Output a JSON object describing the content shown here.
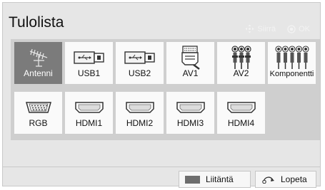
{
  "header": {
    "title": "Tulolista",
    "move_hint": "Siirrä",
    "ok_hint": "OK"
  },
  "inputs": [
    {
      "label": "Antenni",
      "icon": "antenna-icon",
      "selected": true
    },
    {
      "label": "USB1",
      "icon": "usb-icon",
      "selected": false
    },
    {
      "label": "USB2",
      "icon": "usb-icon",
      "selected": false
    },
    {
      "label": "AV1",
      "icon": "scart-icon",
      "selected": false
    },
    {
      "label": "AV2",
      "icon": "rca-3-icon",
      "selected": false
    },
    {
      "label": "Komponentti",
      "icon": "rca-5-icon",
      "selected": false
    },
    {
      "label": "RGB",
      "icon": "vga-icon",
      "selected": false
    },
    {
      "label": "HDMI1",
      "icon": "hdmi-icon",
      "selected": false
    },
    {
      "label": "HDMI2",
      "icon": "hdmi-icon",
      "selected": false
    },
    {
      "label": "HDMI3",
      "icon": "hdmi-icon",
      "selected": false
    },
    {
      "label": "HDMI4",
      "icon": "hdmi-icon",
      "selected": false
    }
  ],
  "footer": {
    "input_button_label": "Liitäntä",
    "exit_button_label": "Lopeta"
  },
  "colors": {
    "panel_background": "#e6e6e6",
    "grid_background": "#cfcfcf",
    "tile_background": "#fafafa",
    "selected_tile": "#7b7b7b"
  }
}
